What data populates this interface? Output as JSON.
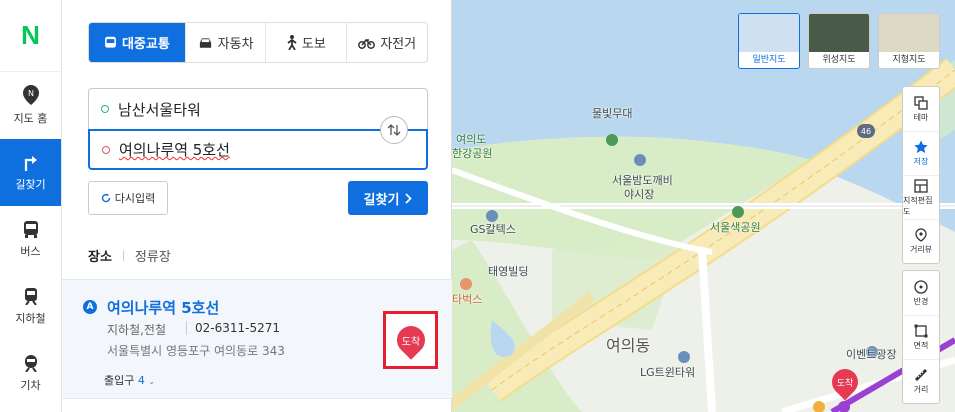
{
  "nav": {
    "logo": "N",
    "items": [
      {
        "label": "지도 홈"
      },
      {
        "label": "길찾기"
      },
      {
        "label": "버스"
      },
      {
        "label": "지하철"
      },
      {
        "label": "기차"
      }
    ]
  },
  "panel": {
    "modes": [
      "대중교통",
      "자동차",
      "도보",
      "자전거"
    ],
    "origin": "남산서울타워",
    "destination": "여의나루역 5호선",
    "reset_label": "다시입력",
    "go_label": "길찾기",
    "tabs": [
      "장소",
      "정류장"
    ],
    "result": {
      "badge": "A",
      "title": "여의나루역 5호선",
      "category": "지하철,전철",
      "phone": "02-6311-5271",
      "address": "서울특별시 영등포구 여의동로 343",
      "exit_label": "출입구",
      "exit_count": "4",
      "pin_label": "도착"
    }
  },
  "map": {
    "labels": {
      "fountain": "물빛무대",
      "park_line1": "여의도",
      "park_line2": "한강공원",
      "market_line1": "서울밤도깨비",
      "market_line2": "야시장",
      "gs": "GS칼텍스",
      "saetgang": "서울색공원",
      "taeyang": "태영빌딩",
      "starbucks": "타벅스",
      "district": "여의동",
      "lg": "LG트윈타워",
      "event": "이벤트광장",
      "road_number": "46",
      "pin": "도착"
    },
    "map_types": [
      "일반지도",
      "위성지도",
      "지형지도"
    ],
    "tools": [
      "테마",
      "저장",
      "지적편집도",
      "거리뷰",
      "반경",
      "면적",
      "거리"
    ],
    "colors": {
      "water": "#b9d7ee",
      "land": "#eef0ea",
      "park": "#d9ecc8",
      "road": "#f5e6a6",
      "accent": "#0f6fde"
    }
  }
}
